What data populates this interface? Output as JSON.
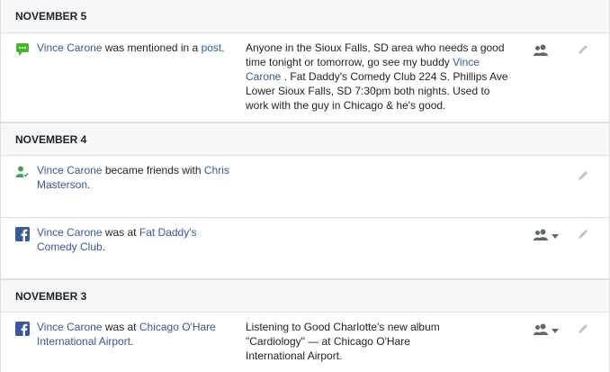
{
  "sections": [
    {
      "date": "NOVEMBER 5",
      "entries": [
        {
          "icon": "mention-comment-icon",
          "actor": "Vince Carone",
          "verb": " was mentioned in a ",
          "target": "post",
          "suffix": ".",
          "detail_pre": "Anyone in the Sioux Falls, SD area who needs a good time tonight or tomorrow, go see my buddy ",
          "detail_link": "Vince Carone",
          "detail_post": " . Fat Daddy's Comedy Club 224 S. Phillips Ave Lower Sioux Falls, SD 7:30pm both nights. Used to work with the guy in Chicago & he's good.",
          "privacy": "friends-icon",
          "privacy_dropdown": false
        }
      ]
    },
    {
      "date": "NOVEMBER 4",
      "entries": [
        {
          "icon": "friends-added-icon",
          "actor": "Vince Carone",
          "verb": " became friends with ",
          "target": "Chris Masterson",
          "suffix": ".",
          "privacy": null
        },
        {
          "icon": "facebook-icon",
          "actor": "Vince Carone",
          "verb": " was at ",
          "target": "Fat Daddy's Comedy Club",
          "suffix": ".",
          "privacy": "friends-icon",
          "privacy_dropdown": true
        }
      ]
    },
    {
      "date": "NOVEMBER 3",
      "entries": [
        {
          "icon": "facebook-icon",
          "actor": "Vince Carone",
          "verb": " was at ",
          "target": "Chicago O'Hare International Airport",
          "suffix": ".",
          "detail_pre": "Listening to Good Charlotte's new album \"Cardiology\" — at Chicago O'Hare International Airport.",
          "privacy": "friends-icon",
          "privacy_dropdown": true
        }
      ]
    }
  ],
  "colors": {
    "link": "#385898",
    "header_bg": "#f6f7f9",
    "border": "#dddfe2",
    "facebook_blue": "#3b5998",
    "mention_green": "#42b72a"
  }
}
